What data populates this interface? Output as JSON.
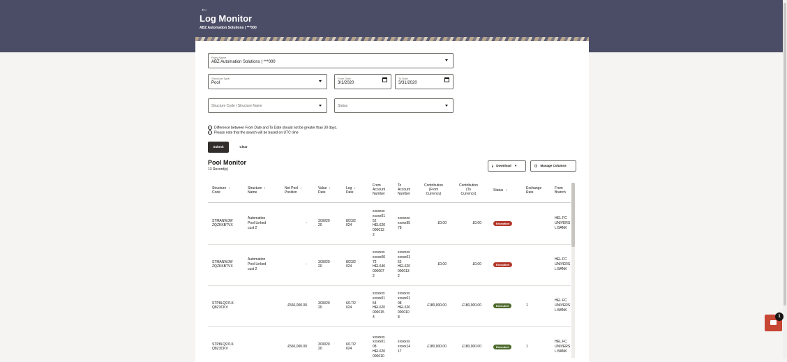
{
  "header": {
    "back_icon": "back-arrow-icon",
    "title": "Log Monitor",
    "subtitle": "ABZ Automation Solutions | ***000"
  },
  "form": {
    "party": {
      "label": "Party Name",
      "value": "ABZ Automation Solutions | ***000"
    },
    "structure_type": {
      "label": "Structure Type",
      "value": "Pool"
    },
    "from_date": {
      "label": "From Date",
      "value": "3/1/2020"
    },
    "to_date": {
      "label": "To Date",
      "value": "3/31/2020"
    },
    "structure_code": {
      "placeholder": "Structure Code | Structure Name"
    },
    "status": {
      "placeholder": "Status"
    },
    "notes": [
      "Difference between From Date and To Date should not be greater than 30 days.",
      "Please note that the search will be based on UTC time"
    ],
    "submit_label": "Submit",
    "clear_label": "Clear"
  },
  "results": {
    "title": "Pool Monitor",
    "count": "13 Record(s)",
    "download_label": "Download",
    "manage_columns_label": "Manage Columns",
    "columns": [
      [
        "Structure",
        "Code"
      ],
      [
        "Structure",
        "Name"
      ],
      [
        "Net Pool",
        "Position"
      ],
      [
        "Value",
        "Date"
      ],
      [
        "Log",
        "Date"
      ],
      [
        "From",
        "Account",
        "Number"
      ],
      [
        "To",
        "Account",
        "Number"
      ],
      [
        "Contribution",
        "(From",
        "Currency)"
      ],
      [
        "Contribution",
        "(To",
        "Currency)"
      ],
      [
        "Status"
      ],
      [
        "Exchange",
        "Rate"
      ],
      [
        "From",
        "Branch"
      ]
    ],
    "rows": [
      {
        "code": [
          "STMANWJW",
          "ZQZKKBTVX"
        ],
        "name": [
          "Automation",
          "Pool Linked",
          "cust 2"
        ],
        "net": [
          "-"
        ],
        "value_date": [
          "3/30/20",
          "20"
        ],
        "log_date": [
          "8/23/2",
          "024"
        ],
        "from_acct": [
          "xxxxxxx",
          "xxxxx01",
          "52",
          "HEL620",
          "000013",
          "2"
        ],
        "to_acct": [
          "xxxxxxx",
          "xxxxx95",
          "78"
        ],
        "contrib_from": "£0.00",
        "contrib_to": "£0.00",
        "status": "Exception",
        "status_color": "#b4372c",
        "rate": "",
        "branch": [
          "HEL FC",
          "UNIVERS",
          "L BANK"
        ]
      },
      {
        "code": [
          "STMANWJW",
          "ZQZKKBTVX"
        ],
        "name": [
          "Automation",
          "Pool Linked",
          "cust 2"
        ],
        "net": [
          "-"
        ],
        "value_date": [
          "3/30/20",
          "20"
        ],
        "log_date": [
          "8/23/2",
          "024"
        ],
        "from_acct": [
          "xxxxxxx",
          "xxxxx00",
          "72",
          "HEL640",
          "000007",
          "2"
        ],
        "to_acct": [
          "xxxxxxx",
          "xxxxx01",
          "52",
          "HEL620",
          "000013",
          "2"
        ],
        "contrib_from": "£0.00",
        "contrib_to": "£0.00",
        "status": "Exception",
        "status_color": "#b4372c",
        "rate": "",
        "branch": [
          "HEL FC",
          "UNIVERS",
          "L BANK"
        ]
      },
      {
        "code": [
          "STP8LQ97LK",
          "Q8Z3CKV"
        ],
        "name": [],
        "net": [
          "£560,000.00"
        ],
        "value_date": [
          "3/30/20",
          "20"
        ],
        "log_date": [
          "6/17/2",
          "024"
        ],
        "from_acct": [
          "xxxxxxx",
          "xxxxx01",
          "54",
          "HEL620",
          "000015",
          "4"
        ],
        "to_acct": [
          "xxxxxxx",
          "xxxxx01",
          "08",
          "HEL620",
          "000010",
          "8"
        ],
        "contrib_from": "£180,000.00",
        "contrib_to": "£180,000.00",
        "status": "Executed",
        "status_color": "#4d6a2c",
        "rate": "1",
        "branch": [
          "HEL FC",
          "UNIVERS",
          "L BANK"
        ]
      },
      {
        "code": [
          "STP8LQ97LK",
          "Q8Z3CKV"
        ],
        "name": [],
        "net": [
          "£560,000.00"
        ],
        "value_date": [
          "3/30/20",
          "20"
        ],
        "log_date": [
          "6/17/2",
          "024"
        ],
        "from_acct": [
          "xxxxxxx",
          "xxxxx01",
          "08",
          "HEL620",
          "000010"
        ],
        "to_acct": [
          "xxxxxxx",
          "xxxxx14",
          "17"
        ],
        "contrib_from": "£180,000.00",
        "contrib_to": "£180,000.00",
        "status": "Executed",
        "status_color": "#4d6a2c",
        "rate": "1",
        "branch": [
          "HEL FC",
          "UNIVERS",
          "L BANK"
        ]
      }
    ]
  },
  "chat": {
    "badge_count": "1",
    "icon": "chat-icon"
  }
}
